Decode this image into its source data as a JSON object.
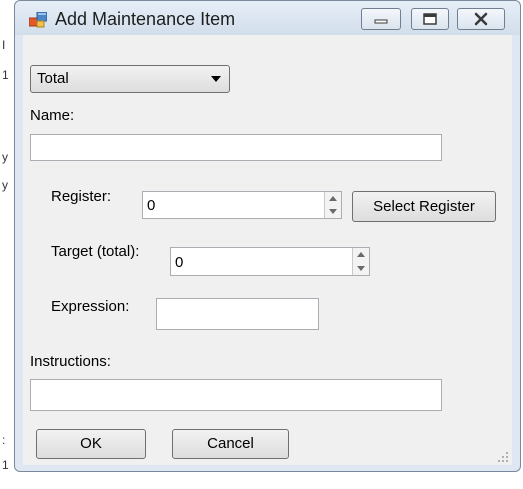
{
  "window": {
    "title": "Add Maintenance Item"
  },
  "form": {
    "type_dropdown": {
      "selected": "Total"
    },
    "name_label": "Name:",
    "name_value": "",
    "register_label": "Register:",
    "register_value": "0",
    "select_register_button": "Select Register",
    "target_label": "Target (total):",
    "target_value": "0",
    "expression_label": "Expression:",
    "expression_value": "",
    "instructions_label": "Instructions:",
    "instructions_value": "",
    "ok_button": "OK",
    "cancel_button": "Cancel"
  },
  "icons": {
    "app": "app-window-icon",
    "minimize": "minimize-icon",
    "maximize": "maximize-icon",
    "close": "close-icon",
    "dropdown": "chevron-down-icon",
    "spin_up": "spin-up-icon",
    "spin_down": "spin-down-icon"
  },
  "colors": {
    "title_bar": "#d2deeb",
    "client": "#f0f0f0",
    "border": "#abadb3"
  }
}
